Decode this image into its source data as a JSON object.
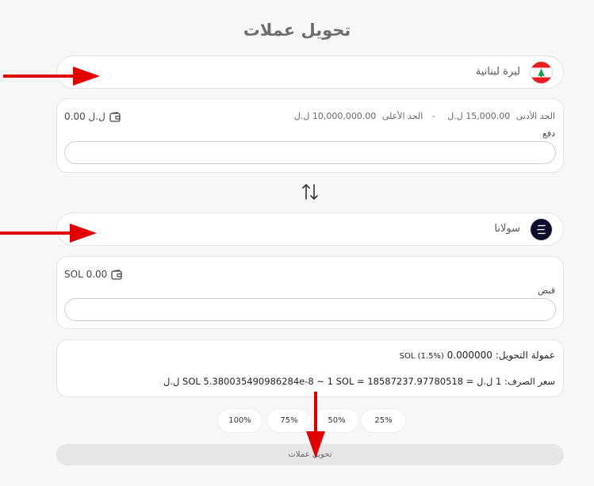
{
  "page": {
    "title": "تحويل عملات"
  },
  "from": {
    "currency_name": "ليرة لبنانية",
    "flag_icon": "lebanon-flag-icon",
    "balance": "0.00 ل.ل",
    "limits": {
      "min_label": "الحد الأدنى",
      "min_value": "15,000.00 ل.ل",
      "separator": "-",
      "max_label": "الحد الأعلى",
      "max_value": "10,000,000.00 ل.ل"
    },
    "field_label": "دفع",
    "value": ""
  },
  "to": {
    "currency_name": "سولانا",
    "flag_icon": "solana-logo-icon",
    "balance": "SOL 0.00",
    "field_label": "قبض",
    "value": ""
  },
  "info": {
    "fee_label": "عمولة التحويل:",
    "fee_value": "0.000000",
    "fee_detail": "SOL (1.5%)",
    "rate_text": "سعر الصرف: 1 ل.ل = SOL 5.380035490986284e-8 ~ 1 SOL = 18587237.97780518 ل.ل"
  },
  "percent_buttons": [
    "100%",
    "75%",
    "50%",
    "25%"
  ],
  "submit_label": "تحويل عملات",
  "colors": {
    "arrow": "#e00000",
    "lebanon_green": "#00a651",
    "lebanon_red": "#ed1c24",
    "solana_bg": "#0b0b2b"
  }
}
